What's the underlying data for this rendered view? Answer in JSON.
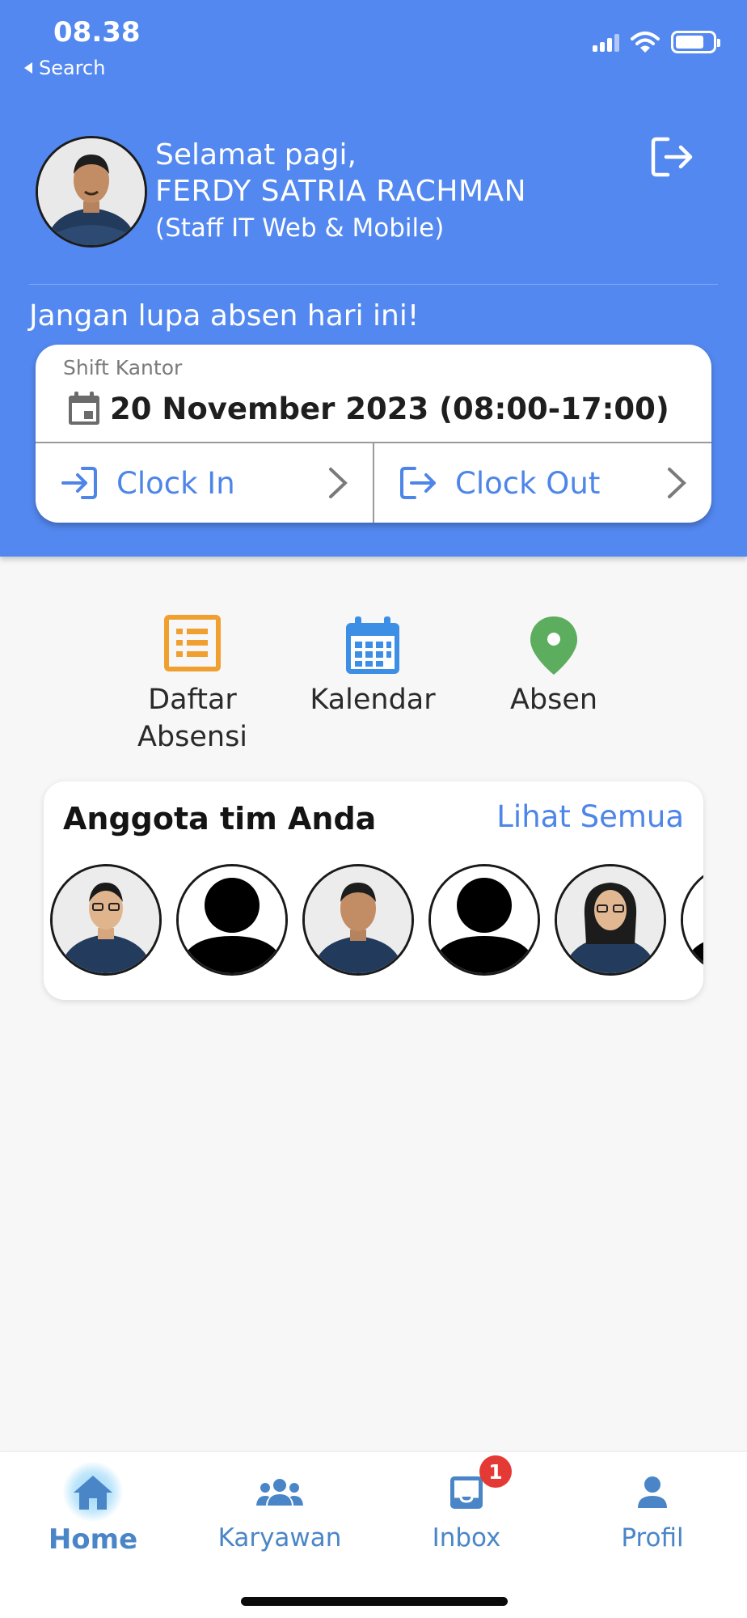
{
  "status_bar": {
    "time": "08.38",
    "back_label": "Search"
  },
  "header": {
    "greeting": "Selamat pagi,",
    "user_name": "FERDY SATRIA RACHMAN",
    "user_role": "(Staff IT Web & Mobile)",
    "reminder": "Jangan lupa absen hari ini!",
    "background_color": "#5388f0"
  },
  "shift": {
    "label": "Shift Kantor",
    "date_time": "20 November 2023 (08:00-17:00)",
    "clock_in_label": "Clock In",
    "clock_out_label": "Clock Out"
  },
  "menu": {
    "daftar_absensi": {
      "line1": "Daftar",
      "line2": "Absensi",
      "icon": "list-icon",
      "color": "#f0a030"
    },
    "kalendar": {
      "label": "Kalendar",
      "icon": "calendar-icon",
      "color": "#3d8fe6"
    },
    "absen": {
      "label": "Absen",
      "icon": "location-pin-icon",
      "color": "#5cad5e"
    }
  },
  "team": {
    "title": "Anggota tim Anda",
    "see_all": "Lihat Semua",
    "members": [
      {
        "avatar": "photo"
      },
      {
        "avatar": "placeholder"
      },
      {
        "avatar": "photo"
      },
      {
        "avatar": "placeholder"
      },
      {
        "avatar": "photo"
      },
      {
        "avatar": "placeholder"
      }
    ]
  },
  "bottom_nav": {
    "home": "Home",
    "karyawan": "Karyawan",
    "inbox": "Inbox",
    "inbox_badge": "1",
    "profil": "Profil",
    "active": "home"
  }
}
